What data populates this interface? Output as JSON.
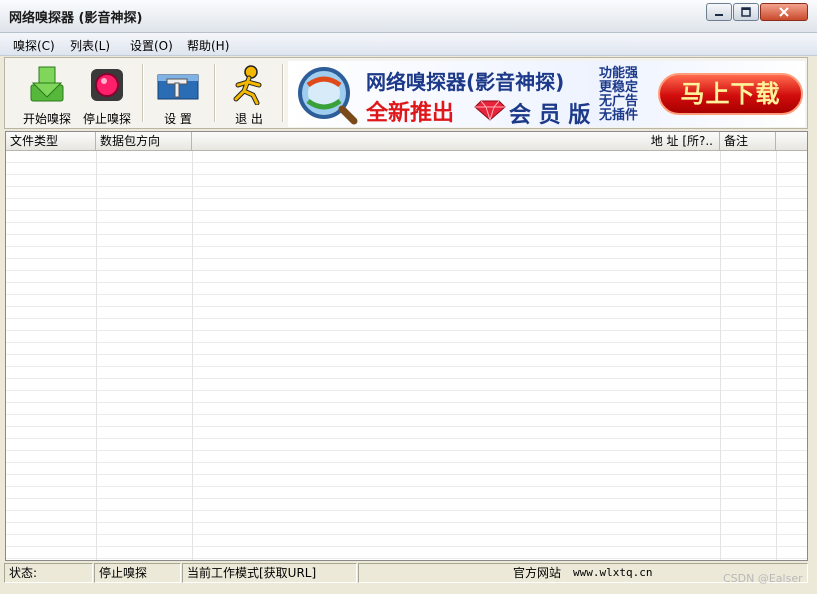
{
  "window": {
    "title": "网络嗅探器 (影音神探)"
  },
  "menu": [
    {
      "label": "嗅探(C)"
    },
    {
      "label": "列表(L)"
    },
    {
      "label": "设置(O)"
    },
    {
      "label": "帮助(H)"
    }
  ],
  "toolbar": {
    "start_label": "开始嗅探",
    "stop_label": "停止嗅探",
    "settings_label": "设 置",
    "exit_label": "退 出"
  },
  "banner": {
    "line1": "网络嗅探器(影音神探)",
    "line2": "全新推出",
    "vip": "会 员 版",
    "features": [
      "功能强",
      "更稳定",
      "无广告",
      "无插件"
    ],
    "download_label": "马上下载"
  },
  "list": {
    "columns": [
      "文件类型",
      "数据包方向",
      "地  址 [所?..",
      "备注",
      ""
    ]
  },
  "status": {
    "label": "状态:",
    "state": "停止嗅探",
    "mode": "当前工作模式[获取URL]",
    "site_label": "官方网站",
    "site_url": "www.wlxtq.cn"
  },
  "watermark": "CSDN @Ealser",
  "colors": {
    "accent_red": "#e0171a",
    "accent_blue": "#1d3a8a"
  }
}
